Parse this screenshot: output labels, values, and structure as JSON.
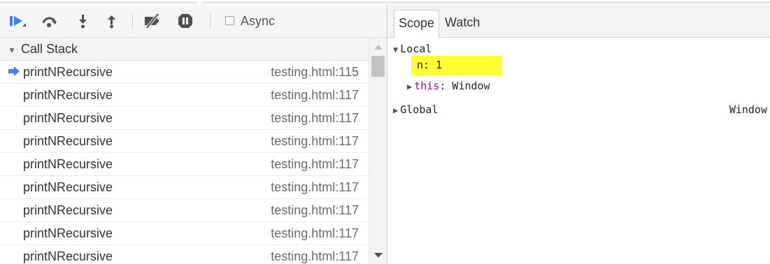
{
  "toolbar": {
    "buttons": [
      {
        "name": "resume-icon",
        "label": "Resume"
      },
      {
        "name": "step-over-icon",
        "label": "Step over"
      },
      {
        "name": "step-into-icon",
        "label": "Step into"
      },
      {
        "name": "step-out-icon",
        "label": "Step out"
      },
      {
        "name": "deactivate-breakpoints-icon",
        "label": "Deactivate breakpoints"
      },
      {
        "name": "pause-on-exceptions-icon",
        "label": "Pause on exceptions"
      }
    ],
    "async_label": "Async",
    "async_checked": false
  },
  "call_stack": {
    "title": "Call Stack",
    "frames": [
      {
        "function": "printNRecursive",
        "location": "testing.html:115",
        "current": true
      },
      {
        "function": "printNRecursive",
        "location": "testing.html:117",
        "current": false
      },
      {
        "function": "printNRecursive",
        "location": "testing.html:117",
        "current": false
      },
      {
        "function": "printNRecursive",
        "location": "testing.html:117",
        "current": false
      },
      {
        "function": "printNRecursive",
        "location": "testing.html:117",
        "current": false
      },
      {
        "function": "printNRecursive",
        "location": "testing.html:117",
        "current": false
      },
      {
        "function": "printNRecursive",
        "location": "testing.html:117",
        "current": false
      },
      {
        "function": "printNRecursive",
        "location": "testing.html:117",
        "current": false
      },
      {
        "function": "printNRecursive",
        "location": "testing.html:117",
        "current": false
      }
    ]
  },
  "tabs": [
    {
      "label": "Scope",
      "active": true
    },
    {
      "label": "Watch",
      "active": false
    }
  ],
  "scope": {
    "local": {
      "label": "Local",
      "expanded": true,
      "vars": [
        {
          "key": "n",
          "value": "1",
          "highlighted": true
        },
        {
          "key": "this",
          "value": "Window",
          "expandable": true
        }
      ]
    },
    "global": {
      "label": "Global",
      "value": "Window",
      "expanded": false
    }
  },
  "colors": {
    "accent": "#3d82f0",
    "highlight": "#ffff33",
    "key_purple": "#881280"
  }
}
